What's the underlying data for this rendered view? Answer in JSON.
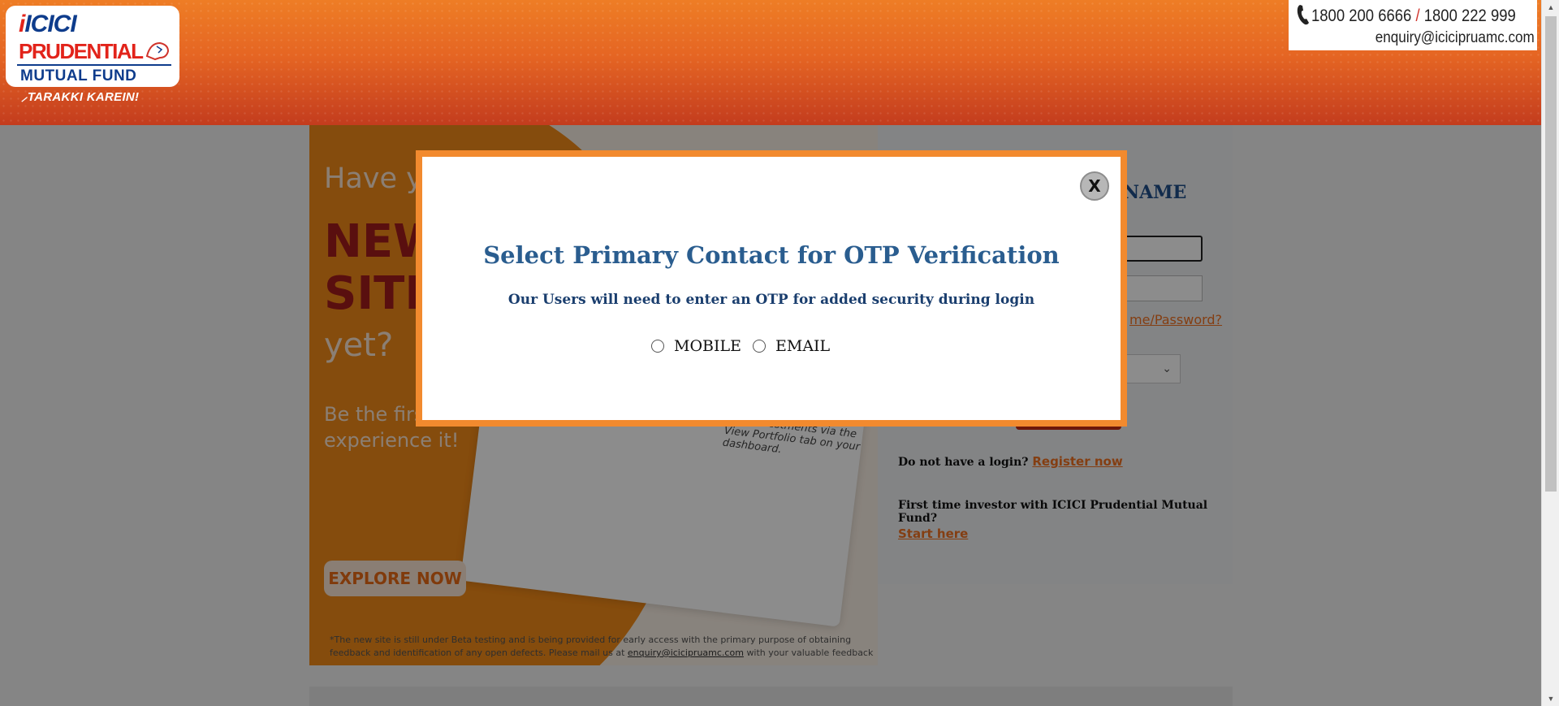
{
  "header": {
    "logo": {
      "line1": "ICICI",
      "line2": "PRUDENTIAL",
      "line3": "MUTUAL FUND",
      "tagline": "TARAKKI KAREIN!"
    },
    "contact": {
      "phone1": "1800 200 6666",
      "separator": "/",
      "phone2": "1800 222 999",
      "email": "enquiry@icicipruamc.com"
    }
  },
  "promo": {
    "line1": "Have yo",
    "line2": "NEW",
    "line3": "SITE",
    "line4": "yet?",
    "line5": "Be the firs",
    "line6": "experience it!",
    "card_text": "Get a detailed account of your investments via the View Portfolio tab on your dashboard.",
    "explore_label": "EXPLORE NOW",
    "note_text": "*The new site is still under Beta testing and is being provided for early access with the primary purpose of obtaining feedback and identification of any open defects. Please mail us at",
    "note_email": "enquiry@icicipruamc.com",
    "note_tail": "with your valuable feedback"
  },
  "login": {
    "heading_fragment": "NAME",
    "forgot_fragment": "me/Password?",
    "no_login_text": "Do not have a login?",
    "register_link": "Register now",
    "first_time_text": "First time investor with ICICI Prudential Mutual Fund?",
    "start_link": "Start here"
  },
  "modal": {
    "close_label": "X",
    "title": "Select Primary Contact for OTP Verification",
    "subtitle": "Our Users will need to enter an OTP for added security during login",
    "options": [
      "MOBILE",
      "EMAIL"
    ]
  },
  "colors": {
    "accent": "#f28a2e",
    "title": "#2a5d8f",
    "link": "#f07222"
  }
}
